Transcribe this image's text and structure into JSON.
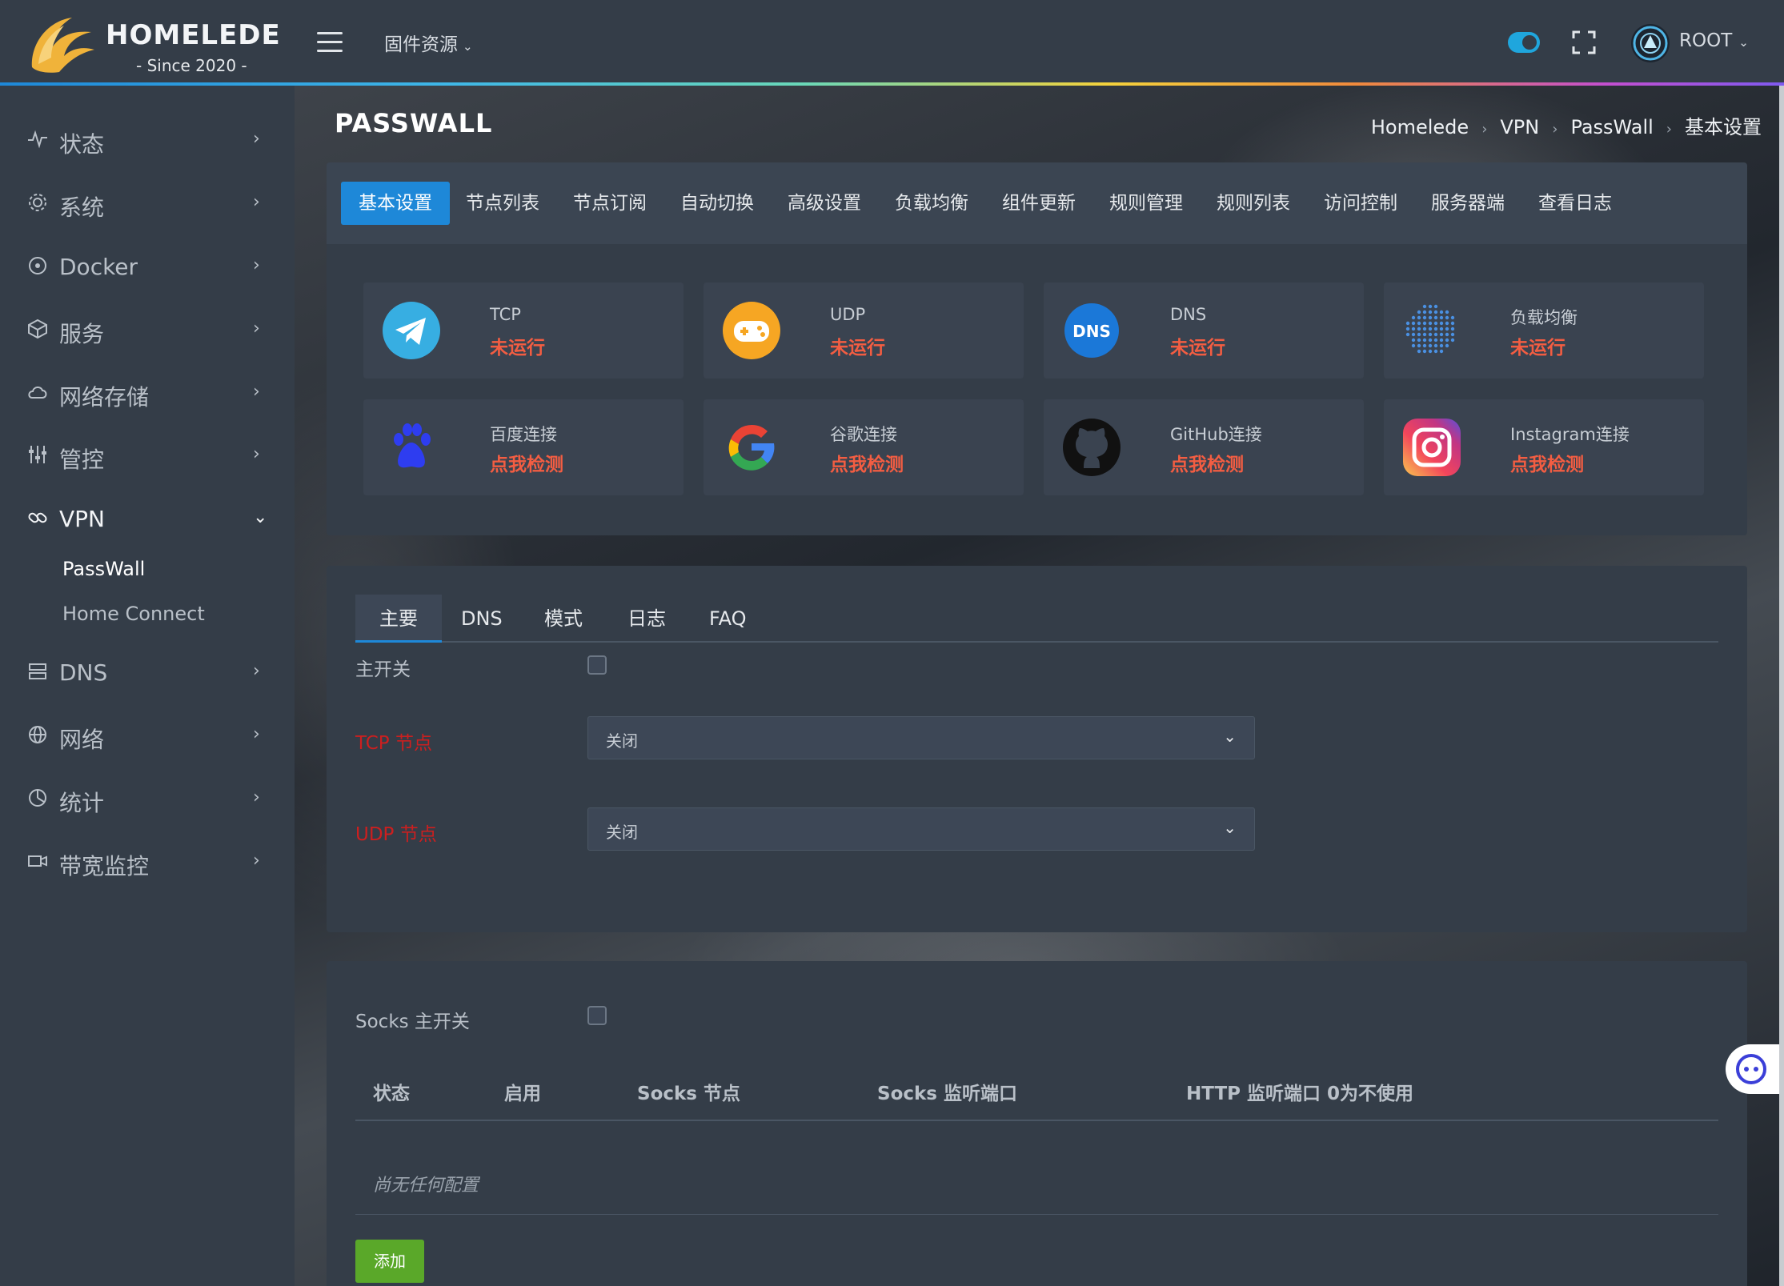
{
  "header": {
    "logo_title": "HOMELEDE",
    "logo_subtitle": "- Since 2020 -",
    "firmware_menu": "固件资源",
    "user_name": "ROOT",
    "toggle_color": "#1fa6dd",
    "rainbow_bar": "gradient-accent"
  },
  "sidebar": {
    "items": [
      {
        "label": "状态",
        "icon": "pulse-icon"
      },
      {
        "label": "系统",
        "icon": "gear-icon"
      },
      {
        "label": "Docker",
        "icon": "target-icon"
      },
      {
        "label": "服务",
        "icon": "cube-icon"
      },
      {
        "label": "网络存储",
        "icon": "cloud-icon"
      },
      {
        "label": "管控",
        "icon": "sliders-icon"
      },
      {
        "label": "VPN",
        "icon": "link-icon"
      },
      {
        "label": "DNS",
        "icon": "server-icon"
      },
      {
        "label": "网络",
        "icon": "globe-icon"
      },
      {
        "label": "统计",
        "icon": "chart-icon"
      },
      {
        "label": "带宽监控",
        "icon": "camera-icon"
      }
    ],
    "vpn_subitems": [
      {
        "label": "PassWall",
        "active": true
      },
      {
        "label": "Home Connect",
        "active": false
      }
    ]
  },
  "page": {
    "title": "PASSWALL",
    "breadcrumb": [
      "Homelede",
      "VPN",
      "PassWall",
      "基本设置"
    ]
  },
  "top_tabs": [
    "基本设置",
    "节点列表",
    "节点订阅",
    "自动切换",
    "高级设置",
    "负载均衡",
    "组件更新",
    "规则管理",
    "规则列表",
    "访问控制",
    "服务器端",
    "查看日志"
  ],
  "status_cards": [
    {
      "title": "TCP",
      "status": "未运行",
      "icon": "telegram-icon"
    },
    {
      "title": "UDP",
      "status": "未运行",
      "icon": "gamepad-icon"
    },
    {
      "title": "DNS",
      "status": "未运行",
      "icon": "dns-icon",
      "icon_text": "DNS"
    },
    {
      "title": "负载均衡",
      "status": "未运行",
      "icon": "dots-sphere-icon"
    },
    {
      "title": "百度连接",
      "status": "点我检测",
      "icon": "baidu-paw-icon"
    },
    {
      "title": "谷歌连接",
      "status": "点我检测",
      "icon": "google-icon"
    },
    {
      "title": "GitHub连接",
      "status": "点我检测",
      "icon": "github-icon"
    },
    {
      "title": "Instagram连接",
      "status": "点我检测",
      "icon": "instagram-icon"
    }
  ],
  "status_color": "#f35d42",
  "main_form": {
    "sub_tabs": [
      "主要",
      "DNS",
      "模式",
      "日志",
      "FAQ"
    ],
    "master_switch_label": "主开关",
    "tcp_node_label": "TCP 节点",
    "tcp_node_value": "关闭",
    "udp_node_label": "UDP 节点",
    "udp_node_value": "关闭"
  },
  "socks": {
    "switch_label": "Socks 主开关",
    "columns": [
      "状态",
      "启用",
      "Socks 节点",
      "Socks 监听端口",
      "HTTP 监听端口 0为不使用"
    ],
    "empty_text": "尚无任何配置",
    "add_button": "添加",
    "add_button_color": "#5aa829"
  }
}
